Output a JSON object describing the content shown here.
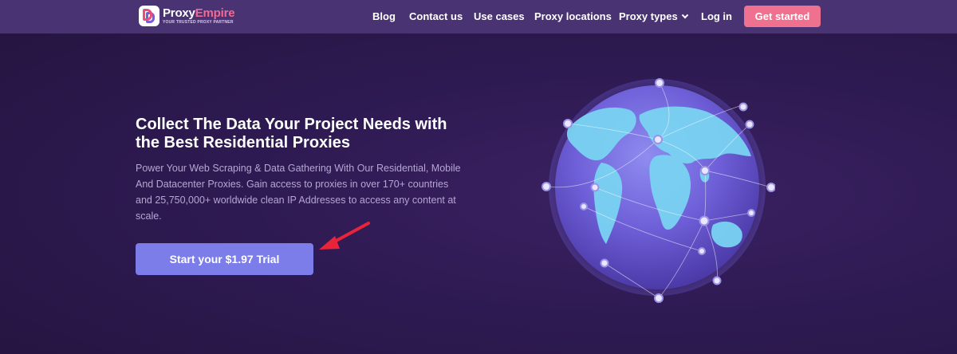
{
  "brand": {
    "name_part1": "Proxy",
    "name_part2": "Empire",
    "tagline": "YOUR TRUSTED PROXY PARTNER"
  },
  "nav": {
    "items": [
      {
        "label": "Blog"
      },
      {
        "label": "Contact us"
      },
      {
        "label": "Use cases"
      },
      {
        "label": "Proxy locations"
      },
      {
        "label": "Proxy types"
      },
      {
        "label": "Log in"
      }
    ],
    "cta_label": "Get started"
  },
  "hero": {
    "title": "Collect The Data Your Project Needs with the Best Residential Proxies",
    "subtitle": "Power Your Web Scraping & Data Gathering With Our Residential, Mobile And Datacenter Proxies. Gain access to proxies in over 170+ countries and 25,750,000+ worldwide clean IP Addresses to access any content at scale.",
    "button_label": "Start your $1.97 Trial"
  },
  "colors": {
    "background": "#2e1a52",
    "navbar": "#4a3373",
    "cta": "#f0708f",
    "trial_button": "#7c7de8",
    "subtitle_text": "#b6a6d3",
    "arrow": "#e8233a"
  },
  "icons": {
    "logo": "proxyempire-logo-icon",
    "dropdown": "chevron-down-icon",
    "pointer": "red-arrow-icon",
    "illustration": "globe-network-icon"
  }
}
